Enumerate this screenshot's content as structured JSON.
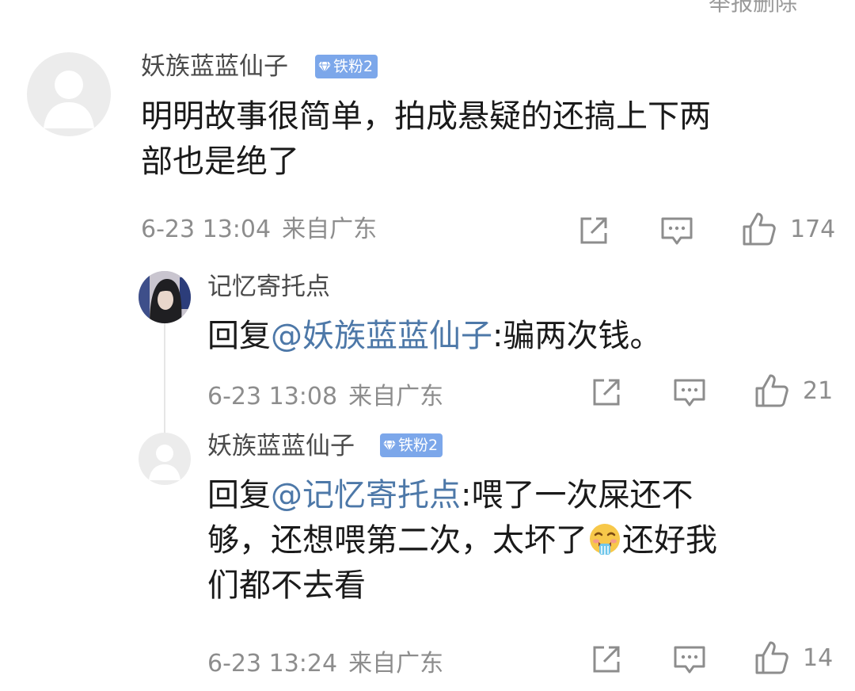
{
  "header": {
    "cut_text": "举报删除"
  },
  "comments": [
    {
      "username": "妖族蓝蓝仙子",
      "badge": "铁粉2",
      "content_line1": "明明故事很简单，拍成悬疑的还搞上下两",
      "content_line2": "部也是绝了",
      "time": "6-23 13:04",
      "location": "来自广东",
      "likes": "174",
      "avatar_icon": "default-avatar-icon"
    }
  ],
  "replies": [
    {
      "username": "记忆寄托点",
      "reply_prefix": "回复",
      "mention": "@妖族蓝蓝仙子",
      "content": ":骗两次钱。",
      "time": "6-23 13:08",
      "location": "来自广东",
      "likes": "21",
      "avatar_icon": "user-photo-avatar"
    },
    {
      "username": "妖族蓝蓝仙子",
      "badge": "铁粉2",
      "reply_prefix": "回复",
      "mention": "@记忆寄托点",
      "content_line1": ":喂了一次屎还不",
      "content_line2a": "够，还想喂第二次，太坏了",
      "content_line2b": "还好我",
      "content_line3": "们都不去看",
      "emoji": "crying-drooling-emoji",
      "time": "6-23 13:24",
      "location": "来自广东",
      "likes": "14",
      "avatar_icon": "default-avatar-icon"
    }
  ],
  "colors": {
    "mention": "#4d78a8",
    "badge": "#7ca7ea",
    "meta": "#8d8d8d"
  }
}
